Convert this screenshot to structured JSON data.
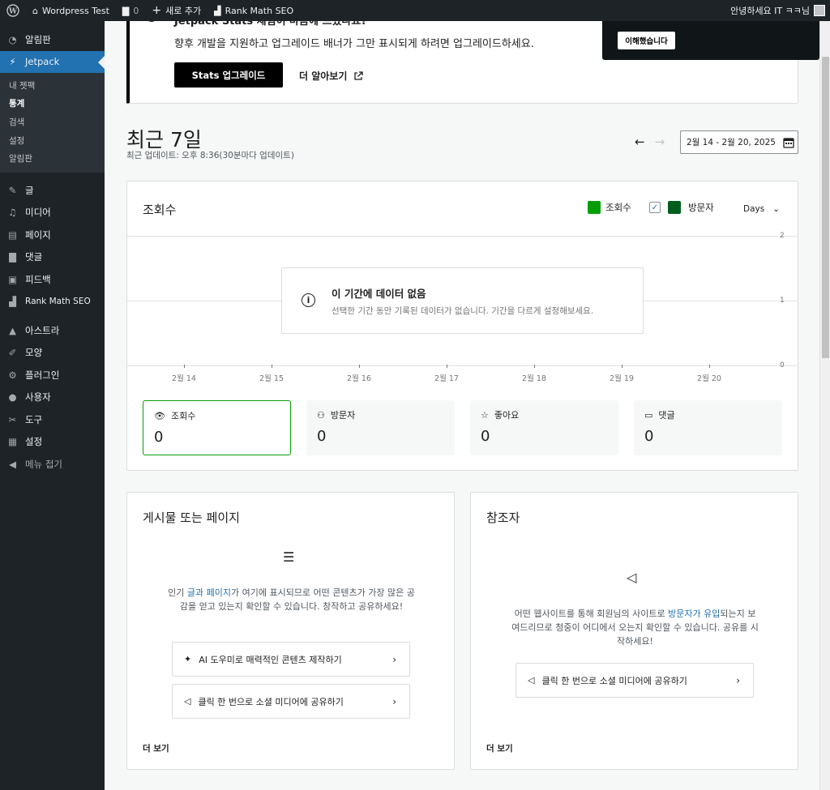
{
  "admin_bar": {
    "site_name": "Wordpress Test",
    "comments_count": "0",
    "new_label": "새로 추가",
    "rank_math": "Rank Math SEO",
    "greeting": "안녕하세요 IT ㅋㅋ님"
  },
  "sidebar": {
    "items_top": [
      {
        "label": "알림판",
        "icon": "dashboard-icon"
      }
    ],
    "jetpack": {
      "label": "Jetpack",
      "icon": "jetpack-icon"
    },
    "submenu": [
      "내 젯팩",
      "통계",
      "검색",
      "설정",
      "알림판"
    ],
    "items": [
      {
        "label": "글",
        "icon": "pin-icon"
      },
      {
        "label": "미디어",
        "icon": "media-icon"
      },
      {
        "label": "페이지",
        "icon": "page-icon"
      },
      {
        "label": "댓글",
        "icon": "comment-icon"
      },
      {
        "label": "피드백",
        "icon": "feedback-icon"
      },
      {
        "label": "Rank Math SEO",
        "icon": "rankmath-icon"
      }
    ],
    "items_bottom": [
      {
        "label": "아스트라",
        "icon": "astra-icon"
      },
      {
        "label": "모양",
        "icon": "brush-icon"
      },
      {
        "label": "플러그인",
        "icon": "plugin-icon"
      },
      {
        "label": "사용자",
        "icon": "user-icon"
      },
      {
        "label": "도구",
        "icon": "wrench-icon"
      },
      {
        "label": "설정",
        "icon": "settings-icon"
      },
      {
        "label": "메뉴 접기",
        "icon": "collapse-icon"
      }
    ]
  },
  "banner": {
    "cut_title": "Jetpack Stats 체험이 마음에 드셨나요?",
    "text": "향후 개발을 지원하고 업그레이드 배너가 그만 표시되게 하려면 업그레이드하세요.",
    "upgrade_button": "Stats 업그레이드",
    "learn_more": "더 알아보기"
  },
  "toast": {
    "button": "이해했습니다"
  },
  "period": {
    "title": "최근 7일",
    "updated": "최근 업데이트: 오후 8:36(30분마다 업데이트)",
    "range": "2월 14 - 2월 20, 2025"
  },
  "chart": {
    "title": "조회수",
    "legend_views": "조회수",
    "legend_visitors": "방문자",
    "period_select": "Days",
    "no_data_title": "이 기간에 데이터 없음",
    "no_data_desc": "선택한 기간 동안 기록된 데이터가 없습니다. 기간을 다르게 설정해보세요.",
    "colors": {
      "views": "#069e08",
      "visitors": "#005e1c"
    }
  },
  "chart_data": {
    "type": "bar",
    "categories": [
      "2월 14",
      "2월 15",
      "2월 16",
      "2월 17",
      "2월 18",
      "2월 19",
      "2월 20"
    ],
    "series": [
      {
        "name": "조회수",
        "values": [
          0,
          0,
          0,
          0,
          0,
          0,
          0
        ]
      },
      {
        "name": "방문자",
        "values": [
          0,
          0,
          0,
          0,
          0,
          0,
          0
        ]
      }
    ],
    "yticks": [
      "2",
      "1",
      "0"
    ],
    "ylim": [
      0,
      2
    ]
  },
  "stats": [
    {
      "label": "조회수",
      "value": "0",
      "icon": "eye-icon"
    },
    {
      "label": "방문자",
      "value": "0",
      "icon": "people-icon"
    },
    {
      "label": "좋아요",
      "value": "0",
      "icon": "star-icon"
    },
    {
      "label": "댓글",
      "value": "0",
      "icon": "comment-icon"
    }
  ],
  "posts_panel": {
    "title": "게시물 또는 페이지",
    "desc_1": "인기 ",
    "link_1": "글과 페이지",
    "desc_2": "가 여기에 표시되므로 어떤 콘텐츠가 가장 많은 공감을 얻고 있는지 확인할 수 있습니다. 창작하고 공유하세요!",
    "action_1": "AI 도우미로 매력적인 콘텐츠 제작하기",
    "action_2": "클릭 한 번으로 소셜 미디어에 공유하기",
    "more": "더 보기"
  },
  "referrers_panel": {
    "title": "참조자",
    "desc_1": "어떤 웹사이트를 통해 회원님의 사이트로 ",
    "link_1": "방문자가 유입",
    "desc_2": "되는지 보여드리므로 청중이 어디에서 오는지 확인할 수 있습니다. 공유를 시작하세요!",
    "action_1": "클릭 한 번으로 소셜 미디어에 공유하기",
    "more": "더 보기"
  }
}
